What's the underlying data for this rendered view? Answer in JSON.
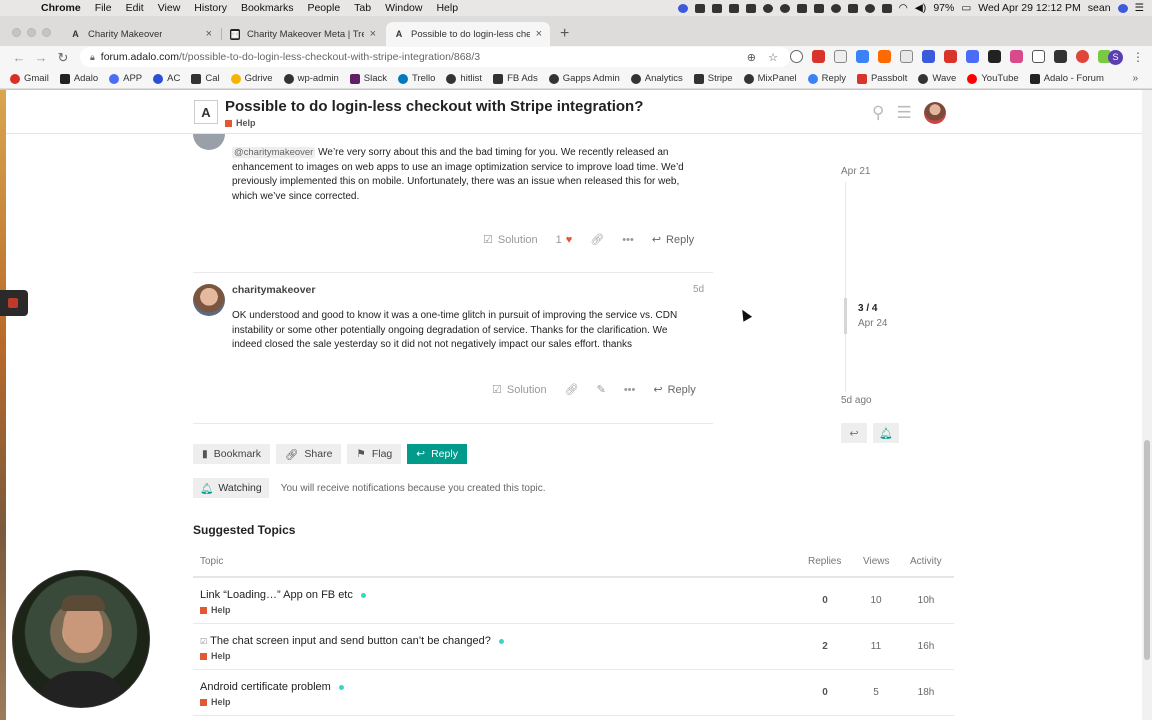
{
  "menubar": {
    "app": "Chrome",
    "items": [
      "File",
      "Edit",
      "View",
      "History",
      "Bookmarks",
      "People",
      "Tab",
      "Window",
      "Help"
    ],
    "battery": "97%",
    "datetime": "Wed Apr 29  12:12 PM",
    "user": "sean"
  },
  "tabs": [
    {
      "title": "Charity Makeover",
      "icon": "A"
    },
    {
      "title": "Charity Makeover Meta | Trello",
      "icon": "▦"
    },
    {
      "title": "Possible to do login-less check",
      "icon": "A"
    }
  ],
  "address": {
    "host": "forum.adalo.com",
    "path": "/t/possible-to-do-login-less-checkout-with-stripe-integration/868/3"
  },
  "profile_initial": "S",
  "bookmarks": [
    {
      "label": "Gmail",
      "color": "#d93025"
    },
    {
      "label": "Adalo",
      "color": "#222222"
    },
    {
      "label": "APP",
      "color": "#4a6cf7"
    },
    {
      "label": "AC",
      "color": "#2b50d8"
    },
    {
      "label": "Cal",
      "color": "#333333"
    },
    {
      "label": "Gdrive",
      "color": "#f4b400"
    },
    {
      "label": "wp-admin",
      "color": "#333333"
    },
    {
      "label": "Slack",
      "color": "#611f69"
    },
    {
      "label": "Trello",
      "color": "#0079bf"
    },
    {
      "label": "hitlist",
      "color": "#333333"
    },
    {
      "label": "FB Ads",
      "color": "#333333"
    },
    {
      "label": "Gapps Admin",
      "color": "#333333"
    },
    {
      "label": "Analytics",
      "color": "#333333"
    },
    {
      "label": "Stripe",
      "color": "#333333"
    },
    {
      "label": "MixPanel",
      "color": "#333333"
    },
    {
      "label": "Reply",
      "color": "#3b82f6"
    },
    {
      "label": "Passbolt",
      "color": "#d9342b"
    },
    {
      "label": "Wave",
      "color": "#333333"
    },
    {
      "label": "YouTube",
      "color": "#ff0000"
    },
    {
      "label": "Adalo - Forum",
      "color": "#222222"
    }
  ],
  "topic": {
    "title": "Possible to do login-less checkout with Stripe integration?",
    "category": "Help"
  },
  "post1": {
    "mention": "@charitymakeover",
    "lines": [
      "We’re very sorry about this and the bad timing for you. We recently released an",
      "enhancement to images on web apps to use an image optimization service to improve load time. We’d",
      "previously implemented this on mobile. Unfortunately, there was an issue when released this for web,",
      "which we’ve since corrected."
    ],
    "solution_label": "Solution",
    "likes": "1",
    "reply_label": "Reply"
  },
  "post2": {
    "username": "charitymakeover",
    "date": "5d",
    "lines": [
      "OK understood and good to know it was a one-time glitch in pursuit of improving the service vs. CDN",
      "instability or some other potentially ongoing degradation of service. Thanks for the clarification. We",
      "indeed closed the sale yesterday so it did not not negatively impact our sales effort. thanks"
    ],
    "solution_label": "Solution",
    "reply_label": "Reply"
  },
  "timeline": {
    "top_date": "Apr 21",
    "position": "3 / 4",
    "current_date": "Apr 24",
    "bottom": "5d ago"
  },
  "footer": {
    "bookmark": "Bookmark",
    "share": "Share",
    "flag": "Flag",
    "reply": "Reply",
    "watching": "Watching",
    "watching_text": "You will receive notifications because you created this topic."
  },
  "suggested": {
    "title": "Suggested Topics",
    "headers": {
      "topic": "Topic",
      "replies": "Replies",
      "views": "Views",
      "activity": "Activity"
    },
    "rows": [
      {
        "title": "Link “Loading…” App on FB etc",
        "category": "Help",
        "replies": "0",
        "views": "10",
        "activity": "10h",
        "solved": false
      },
      {
        "title": "The chat screen input and send button can’t be changed?",
        "category": "Help",
        "replies": "2",
        "views": "11",
        "activity": "16h",
        "solved": true
      },
      {
        "title": "Android certificate problem",
        "category": "Help",
        "replies": "0",
        "views": "5",
        "activity": "18h",
        "solved": false
      }
    ]
  }
}
